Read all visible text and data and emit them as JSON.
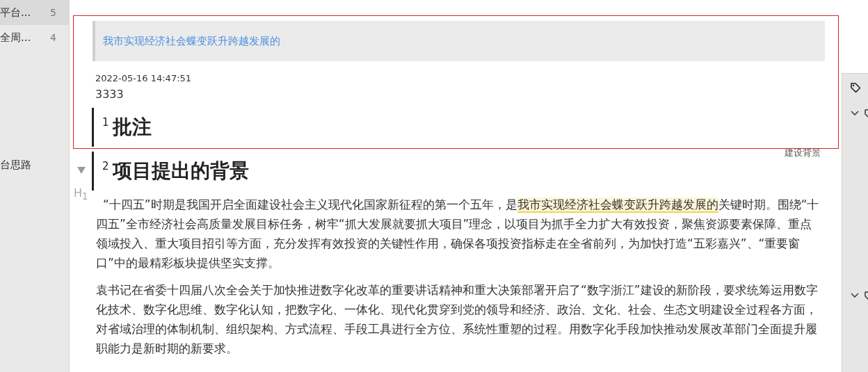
{
  "sidebar": {
    "items": [
      {
        "label": "平台...",
        "count": "5",
        "selected": true
      },
      {
        "label": "全周...",
        "count": "4",
        "selected": false
      },
      {
        "label": "台思路",
        "selected": false
      }
    ]
  },
  "comment_popup": {
    "quote": "我市实现经济社会蝶变跃升跨越发展的",
    "time": "2022-05-16 14:47:51",
    "text": "3333"
  },
  "document": {
    "headings": [
      {
        "number": "1",
        "title": "批注",
        "collapsible": false
      },
      {
        "number": "2",
        "title": "项目提出的背景",
        "collapsible": true,
        "level_label": "H$_{1}$",
        "side_note": "建设背景"
      }
    ],
    "paragraphs": [
      {
        "segments": [
          {
            "text": "“十四五”时期是我国开启全面建设社会主义现代化国家新征程的第一个五年，是",
            "highlighted": false
          },
          {
            "text": "我市实现经济社会蝶变跃升跨越发展的",
            "highlighted": true
          },
          {
            "text": "关键时期。围绕“十四五”全市经济社会高质量发展目标任务，树牢“抓大发展就要抓大项目”理念，以项目为抓手全力扩大有效投资，聚焦资源要素保障、重点领域投入、重大项目招引等方面，充分发挥有效投资的关键性作用，确保各项投资指标走在全省前列，为加快打造“五彩嘉兴”、“重要窗口”中的最精彩板块提供坚实支撑。",
            "highlighted": false
          }
        ]
      },
      {
        "segments": [
          {
            "text": "袁书记在省委十四届八次全会关于加快推进数字化改革的重要讲话精神和重大决策部署开启了“数字浙江”建设的新阶段，要求统筹运用数字化技术、数字化思维、数字化认知，把数字化、一体化、现代化贯穿到党的领导和经济、政治、文化、社会、生态文明建设全过程各方面，对省域治理的体制机制、组织架构、方式流程、手段工具进行全方位、系统性重塑的过程。用数字化手段加快推动发展改革部门全面提升履职能力是新时期的新要求。",
            "highlighted": false
          }
        ]
      }
    ]
  },
  "right_panel": {
    "groups": [
      {
        "expanded": true
      },
      {
        "expanded": true
      }
    ]
  }
}
